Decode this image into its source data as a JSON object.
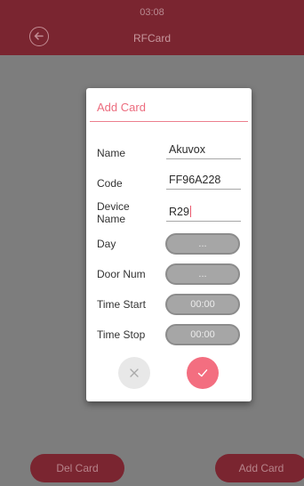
{
  "status": {
    "time": "03:08"
  },
  "header": {
    "title": "RFCard",
    "back_icon": "back-arrow-icon"
  },
  "dialog": {
    "title": "Add Card",
    "fields": [
      {
        "label": "Name",
        "value": "Akuvox"
      },
      {
        "label": "Code",
        "value": "FF96A228"
      },
      {
        "label": "Device Name",
        "value": "R29"
      }
    ],
    "selects": [
      {
        "label": "Day",
        "value": "..."
      },
      {
        "label": "Door Num",
        "value": "..."
      },
      {
        "label": "Time Start",
        "value": "00:00"
      },
      {
        "label": "Time Stop",
        "value": "00:00"
      }
    ],
    "cancel_icon": "close-icon",
    "confirm_icon": "check-icon"
  },
  "bottom": {
    "del_label": "Del Card",
    "add_label": "Add Card"
  },
  "colors": {
    "bar": "#7a2530",
    "accent": "#f36e80",
    "overlay": "#7d7d7d",
    "pill": "#a6a6a6"
  }
}
